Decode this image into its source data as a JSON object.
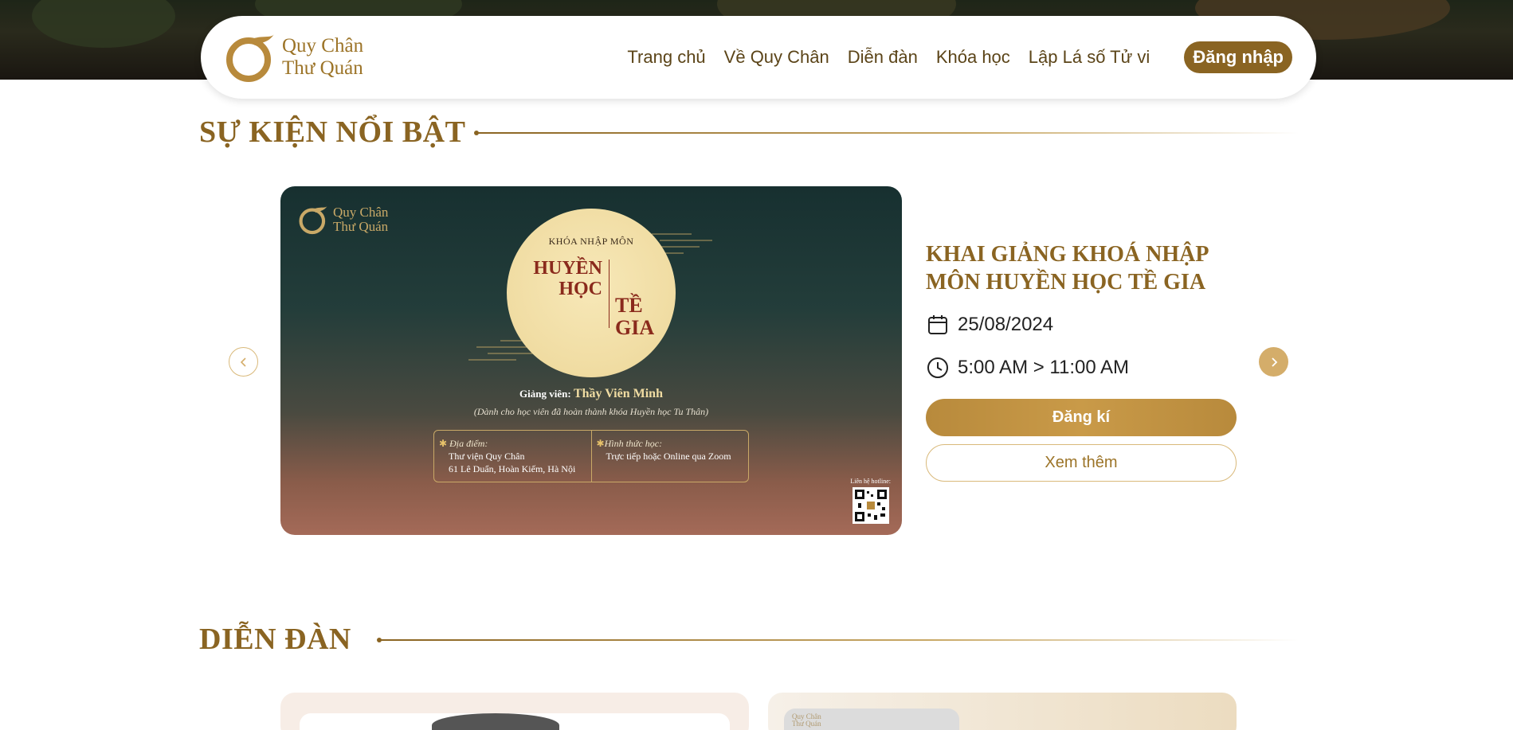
{
  "brand": {
    "name_line1": "Quy Chân",
    "name_line2": "Thư Quán"
  },
  "nav": {
    "items": [
      {
        "label": "Trang chủ"
      },
      {
        "label": "Về Quy Chân"
      },
      {
        "label": "Diễn đàn"
      },
      {
        "label": "Khóa học"
      },
      {
        "label": "Lập Lá số Tử vi"
      }
    ],
    "login_label": "Đăng nhập"
  },
  "featured": {
    "section_title": "SỰ KIỆN NỔI BẬT",
    "banner": {
      "logo_line1": "Quy Chân",
      "logo_line2": "Thư Quán",
      "subtitle": "KHÓA NHẬP MÔN",
      "title_left_1": "HUYỀN",
      "title_left_2": "HỌC",
      "title_right_1": "TỀ",
      "title_right_2": "GIA",
      "teacher_label": "Giảng viên:",
      "teacher_name": "Thầy Viên Minh",
      "note": "(Dành cho học viên đã hoàn thành khóa Huyền học Tu Thân)",
      "location_label": "Địa điểm:",
      "location_line1": "Thư viện Quy Chân",
      "location_line2": "61 Lê Duẩn, Hoàn Kiếm, Hà Nội",
      "format_label": "Hình thức học:",
      "format_value": "Trực tiếp hoặc Online qua Zoom",
      "hotline_label": "Liên hệ hotline:"
    },
    "event": {
      "title": "KHAI GIẢNG KHOÁ NHẬP MÔN HUYỀN HỌC TỀ GIA",
      "date": "25/08/2024",
      "time": "5:00 AM > 11:00 AM",
      "register_label": "Đăng kí",
      "more_label": "Xem thêm"
    }
  },
  "forum": {
    "section_title": "DIỄN ĐÀN",
    "card2_logo_line1": "Quy Chân",
    "card2_logo_line2": "Thư Quán"
  },
  "colors": {
    "brand_gold": "#8a6422",
    "accent_gold": "#c99a48"
  }
}
